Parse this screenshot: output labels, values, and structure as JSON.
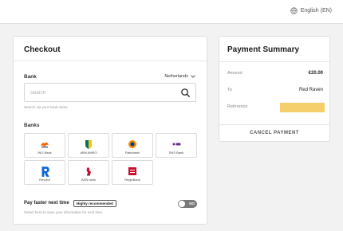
{
  "topbar": {
    "language": "English (EN)",
    "icon": "globe-icon"
  },
  "checkout": {
    "title": "Checkout",
    "bank_label": "Bank",
    "country": "Netherlands",
    "search_placeholder": "Search",
    "search_helper": "Search via your bank name",
    "banks_label": "Banks",
    "banks": [
      {
        "name": "ING Bank",
        "icon": "ing-lion-icon"
      },
      {
        "name": "ABN AMRO",
        "icon": "abn-amro-shield-icon"
      },
      {
        "name": "Rabobank",
        "icon": "rabobank-icon"
      },
      {
        "name": "SNS Bank",
        "icon": "sns-icon"
      },
      {
        "name": "Revolut",
        "icon": "revolut-icon"
      },
      {
        "name": "ASN bank",
        "icon": "asn-bank-icon"
      },
      {
        "name": "RegioBank",
        "icon": "regiobank-icon"
      }
    ],
    "pay_faster": "Pay faster next time",
    "badge": "Highly recommended",
    "pay_faster_helper": "Select here to save your information for next time.",
    "toggle_text": "NO"
  },
  "summary": {
    "title": "Payment Summary",
    "amount_label": "Amount",
    "amount_value": "€20.00",
    "to_label": "To",
    "to_value": "Red Raven",
    "reference_label": "Reference",
    "cancel_label": "CANCEL PAYMENT"
  },
  "colors": {
    "accent": "#f5cf6b",
    "toggle_off": "#7a7a7a"
  }
}
